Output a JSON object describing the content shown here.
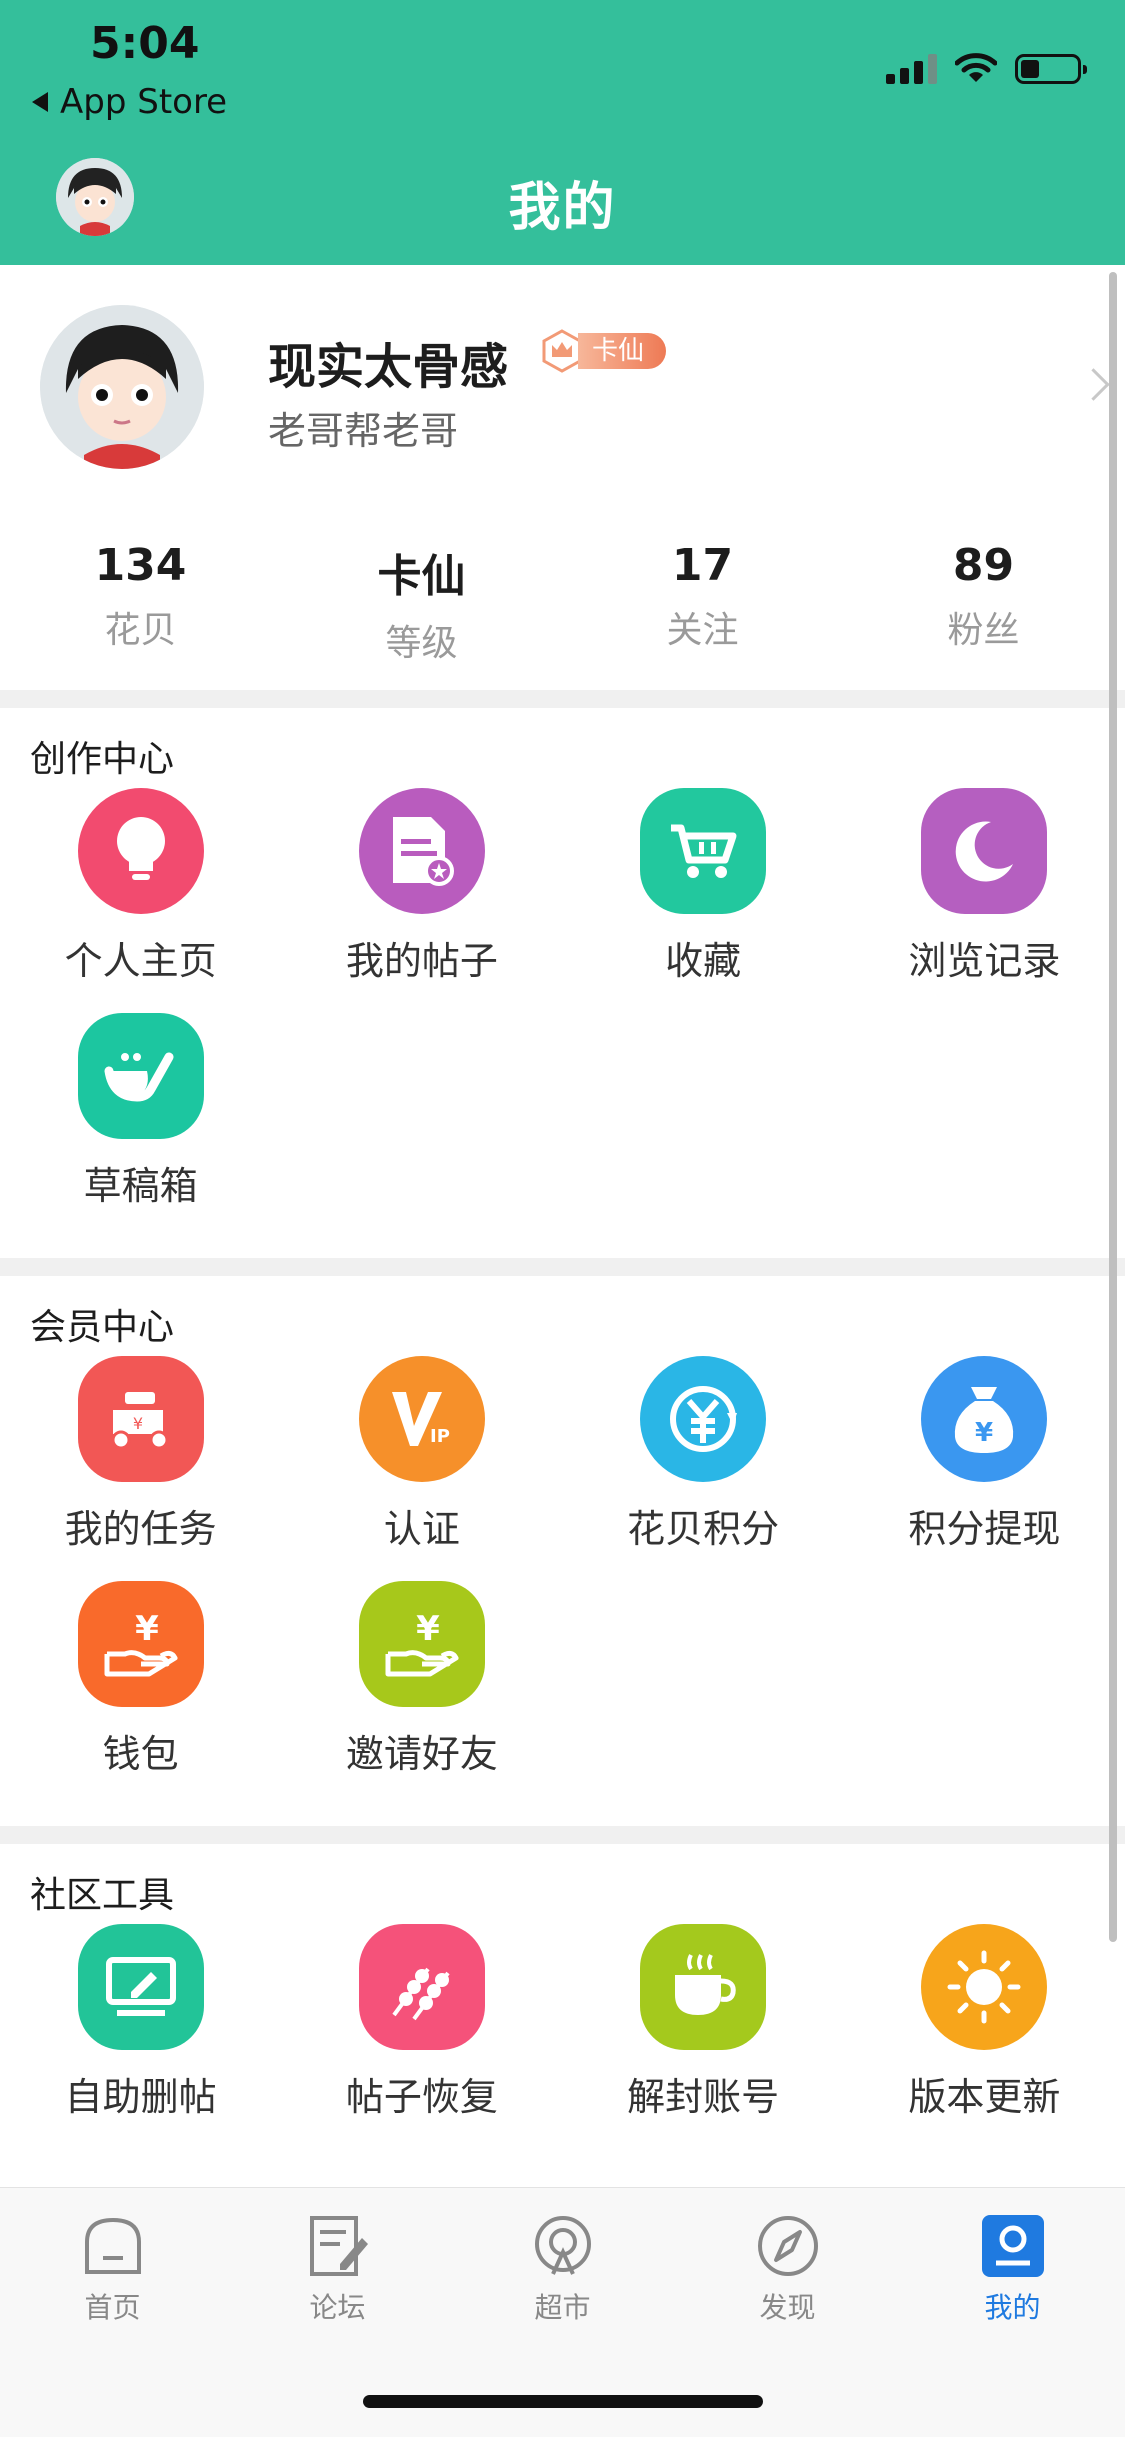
{
  "status_bar": {
    "time": "5:04",
    "back_app": "App Store"
  },
  "header": {
    "title": "我的"
  },
  "profile": {
    "nickname": "现实太骨感",
    "level_badge": "卡仙",
    "signature": "老哥帮老哥",
    "stats": [
      {
        "value": "134",
        "label": "花贝"
      },
      {
        "value": "卡仙",
        "label": "等级"
      },
      {
        "value": "17",
        "label": "关注"
      },
      {
        "value": "89",
        "label": "粉丝"
      }
    ]
  },
  "sections": {
    "creation": {
      "title": "创作中心",
      "items": [
        {
          "label": "个人主页",
          "icon": "lightbulb-icon",
          "color": "#f24b6f"
        },
        {
          "label": "我的帖子",
          "icon": "document-icon",
          "color": "#b95cbe"
        },
        {
          "label": "收藏",
          "icon": "cart-icon",
          "color": "#22c89e"
        },
        {
          "label": "浏览记录",
          "icon": "moon-icon",
          "color": "#b55fc0"
        },
        {
          "label": "草稿箱",
          "icon": "dustpan-icon",
          "color": "#1cc6a0"
        }
      ]
    },
    "member": {
      "title": "会员中心",
      "items": [
        {
          "label": "我的任务",
          "icon": "scooter-icon",
          "color": "#f25755"
        },
        {
          "label": "认证",
          "icon": "vip-icon",
          "color": "#f6902a"
        },
        {
          "label": "花贝积分",
          "icon": "yuan-exchange-icon",
          "color": "#2ab6e6"
        },
        {
          "label": "积分提现",
          "icon": "money-bag-icon",
          "color": "#3a97f0"
        },
        {
          "label": "钱包",
          "icon": "hand-yuan-icon",
          "color": "#f96a2b"
        },
        {
          "label": "邀请好友",
          "icon": "hand-yuan-green-icon",
          "color": "#a7c81b"
        }
      ]
    },
    "tools": {
      "title": "社区工具",
      "items": [
        {
          "label": "自助删帖",
          "icon": "monitor-edit-icon",
          "color": "#22c498"
        },
        {
          "label": "帖子恢复",
          "icon": "skewers-icon",
          "color": "#f5527a"
        },
        {
          "label": "解封账号",
          "icon": "coffee-cup-icon",
          "color": "#a4c91d"
        },
        {
          "label": "版本更新",
          "icon": "sun-icon",
          "color": "#f7a51b"
        }
      ]
    }
  },
  "tabbar": {
    "tabs": [
      {
        "label": "首页",
        "icon": "home-icon",
        "active": false
      },
      {
        "label": "论坛",
        "icon": "forum-icon",
        "active": false
      },
      {
        "label": "超市",
        "icon": "market-icon",
        "active": false
      },
      {
        "label": "发现",
        "icon": "compass-icon",
        "active": false
      },
      {
        "label": "我的",
        "icon": "me-icon",
        "active": true
      }
    ]
  }
}
